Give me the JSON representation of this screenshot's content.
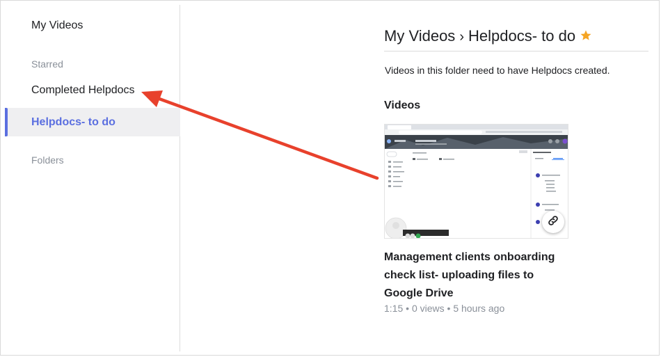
{
  "sidebar": {
    "my_videos": "My Videos",
    "starred_heading": "Starred",
    "starred_items": [
      "Completed Helpdocs",
      "Helpdocs- to do"
    ],
    "folders_heading": "Folders"
  },
  "breadcrumb": {
    "root": "My Videos",
    "separator": "›",
    "current": "Helpdocs- to do",
    "star_color": "#f5a524"
  },
  "folder": {
    "description": "Videos in this folder need to have Helpdocs created."
  },
  "videos": {
    "section_title": "Videos",
    "items": [
      {
        "title": "Management clients onboarding check list- uploading files to Google Drive",
        "duration": "1:15",
        "views": "0 views",
        "age": "5 hours ago"
      }
    ]
  },
  "colors": {
    "accent": "#5b6fe0",
    "arrow": "#e8412c",
    "muted_text": "#8a9099"
  }
}
